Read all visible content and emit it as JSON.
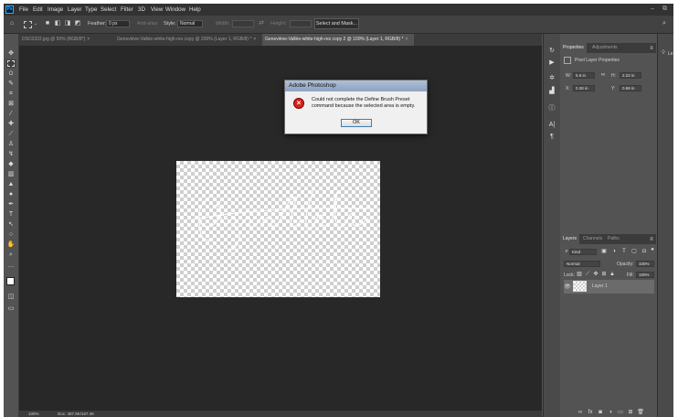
{
  "menubar": {
    "logo": "Ps",
    "items": [
      "File",
      "Edit",
      "Image",
      "Layer",
      "Type",
      "Select",
      "Filter",
      "3D",
      "View",
      "Window",
      "Help"
    ]
  },
  "options_bar": {
    "feather_label": "Feather:",
    "feather_value": "0 px",
    "anti_alias": "Anti-alias",
    "style_label": "Style:",
    "style_value": "Normal",
    "width_label": "Width:",
    "height_label": "Height:",
    "select_mask_button": "Select and Mask..."
  },
  "doc_tabs": [
    {
      "label": "DSC0322.jpg @ 50% (RGB/8*)",
      "close": "×"
    },
    {
      "label": "Geneviève-Vallée-white-high-res copy @ 200% (Layer 1, RGB/8) *",
      "close": "×"
    },
    {
      "label": "Geneviève-Vallée-white-high-res copy 2 @ 100% (Layer 1, RGB/8) *",
      "close": "×"
    }
  ],
  "status_bar": {
    "zoom": "100%",
    "doc_size": "Doc: 487.8K/167.4K"
  },
  "properties_panel": {
    "tabs": [
      "Properties",
      "Adjustments"
    ],
    "section_title": "Pixel Layer Properties",
    "w_label": "W:",
    "w_value": "5.6 in",
    "h_label": "H:",
    "h_value": "2.22 in",
    "x_label": "X:",
    "x_value": "0.38 in",
    "y_label": "Y:",
    "y_value": "0.88 in"
  },
  "layers_panel": {
    "tabs": [
      "Layers",
      "Channels",
      "Paths"
    ],
    "filter_value": "Kind",
    "blend_mode": "Normal",
    "opacity_label": "Opacity:",
    "opacity_value": "100%",
    "lock_label": "Lock:",
    "fill_label": "Fill:",
    "fill_value": "100%",
    "layers": [
      {
        "name": "Layer 1",
        "visible": true
      }
    ]
  },
  "dialog": {
    "title": "Adobe Photoshop",
    "message": "Could not complete the Define Brush Preset command because the selected area is empty.",
    "ok_button": "OK"
  },
  "far_right": {
    "label": "Le"
  },
  "colors": {
    "canvas_bg": "#282828",
    "ui_bg": "#535353",
    "menubar_bg": "#323232",
    "error_red": "#d9231b",
    "dialog_title": "#aebfd6"
  }
}
